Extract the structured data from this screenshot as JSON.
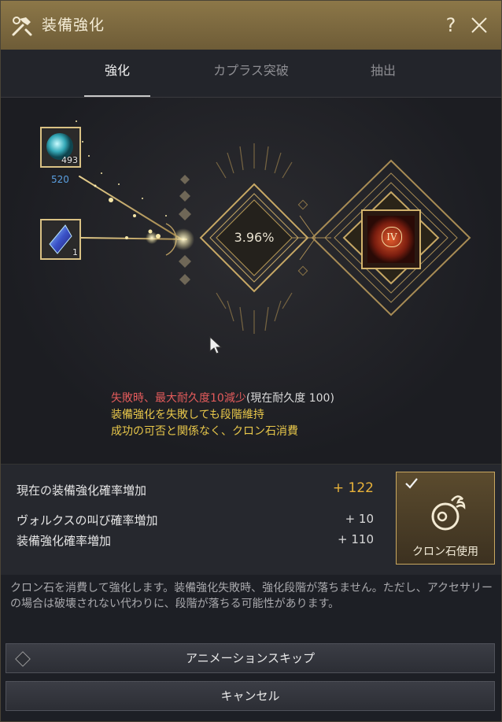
{
  "window": {
    "title": "装備強化",
    "help_label": "?",
    "accent": "#c9a860"
  },
  "tabs": [
    {
      "label": "強化",
      "active": true
    },
    {
      "label": "カプラス突破",
      "active": false
    },
    {
      "label": "抽出",
      "active": false
    }
  ],
  "materials": {
    "top": {
      "icon": "blackstone-icon",
      "count": "493",
      "below": "520"
    },
    "bottom": {
      "icon": "crystal-icon",
      "count": "1"
    }
  },
  "enhance": {
    "rate": "3.96%",
    "grade": "IV"
  },
  "warnings": {
    "line1_red": "失敗時、最大耐久度10減少",
    "line1_gray": "(現在耐久度 100)",
    "line2": "装備強化を失敗しても段階維持",
    "line3": "成功の可否と関係なく、クロン石消費"
  },
  "stats": {
    "total_label": "現在の装備強化確率増加",
    "total_value": "+ 122",
    "valks_label": "ヴォルクスの叫び確率増加",
    "valks_value": "+ 10",
    "base_label": "装備強化確率増加",
    "base_value": "+ 110"
  },
  "clon_button": {
    "label": "クロン石使用",
    "checked": true
  },
  "description": "クロン石を消費して強化します。装備強化失敗時、強化段階が落ちません。ただし、アクセサリーの場合は破壊されない代わりに、段階が落ちる可能性があります。",
  "buttons": {
    "skip": "アニメーションスキップ",
    "cancel": "キャンセル"
  }
}
